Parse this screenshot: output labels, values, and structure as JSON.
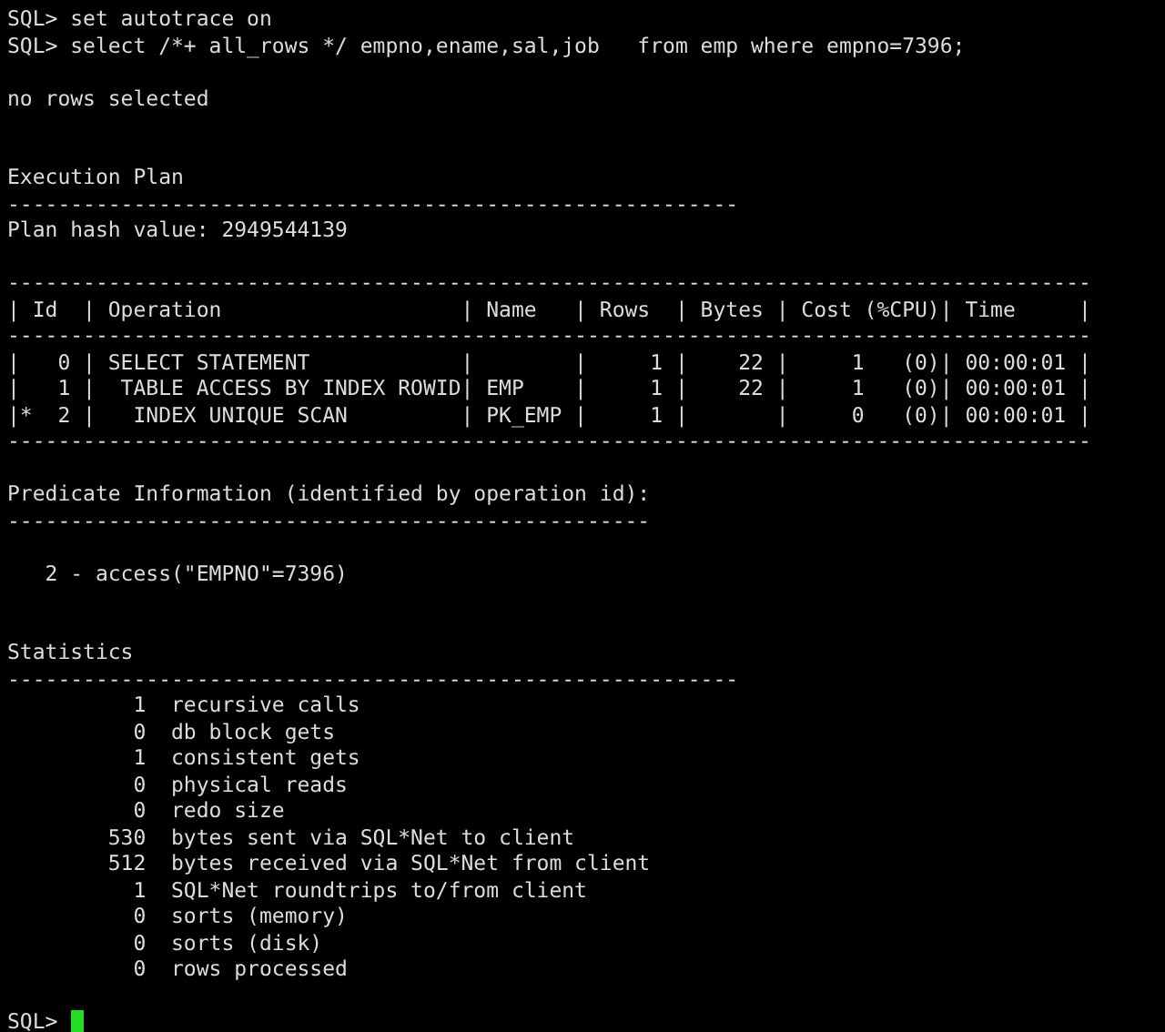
{
  "terminal": {
    "lines": [
      {
        "kind": "text",
        "text": "SQL> set autotrace on"
      },
      {
        "kind": "text",
        "text": "SQL> select /*+ all_rows */ empno,ename,sal,job   from emp where empno=7396;"
      },
      {
        "kind": "blank"
      },
      {
        "kind": "text",
        "text": "no rows selected"
      },
      {
        "kind": "blank"
      },
      {
        "kind": "blank"
      },
      {
        "kind": "text",
        "text": "Execution Plan"
      },
      {
        "kind": "rule",
        "text": "----------------------------------------------------------"
      },
      {
        "kind": "text",
        "text": "Plan hash value: 2949544139"
      },
      {
        "kind": "blank"
      },
      {
        "kind": "rule",
        "text": "--------------------------------------------------------------------------------------"
      },
      {
        "kind": "text",
        "text": "| Id  | Operation                   | Name   | Rows  | Bytes | Cost (%CPU)| Time     |"
      },
      {
        "kind": "rule",
        "text": "--------------------------------------------------------------------------------------"
      },
      {
        "kind": "text",
        "text": "|   0 | SELECT STATEMENT            |        |     1 |    22 |     1   (0)| 00:00:01 |"
      },
      {
        "kind": "text",
        "text": "|   1 |  TABLE ACCESS BY INDEX ROWID| EMP    |     1 |    22 |     1   (0)| 00:00:01 |"
      },
      {
        "kind": "text",
        "text": "|*  2 |   INDEX UNIQUE SCAN         | PK_EMP |     1 |       |     0   (0)| 00:00:01 |"
      },
      {
        "kind": "rule",
        "text": "--------------------------------------------------------------------------------------"
      },
      {
        "kind": "blank"
      },
      {
        "kind": "text",
        "text": "Predicate Information (identified by operation id):"
      },
      {
        "kind": "rule",
        "text": "---------------------------------------------------"
      },
      {
        "kind": "blank"
      },
      {
        "kind": "text",
        "text": "   2 - access(\"EMPNO\"=7396)"
      },
      {
        "kind": "blank"
      },
      {
        "kind": "blank"
      },
      {
        "kind": "text",
        "text": "Statistics"
      },
      {
        "kind": "rule",
        "text": "----------------------------------------------------------"
      },
      {
        "kind": "text",
        "text": "          1  recursive calls"
      },
      {
        "kind": "text",
        "text": "          0  db block gets"
      },
      {
        "kind": "text",
        "text": "          1  consistent gets"
      },
      {
        "kind": "text",
        "text": "          0  physical reads"
      },
      {
        "kind": "text",
        "text": "          0  redo size"
      },
      {
        "kind": "text",
        "text": "        530  bytes sent via SQL*Net to client"
      },
      {
        "kind": "text",
        "text": "        512  bytes received via SQL*Net from client"
      },
      {
        "kind": "text",
        "text": "          1  SQL*Net roundtrips to/from client"
      },
      {
        "kind": "text",
        "text": "          0  sorts (memory)"
      },
      {
        "kind": "text",
        "text": "          0  sorts (disk)"
      },
      {
        "kind": "text",
        "text": "          0  rows processed"
      },
      {
        "kind": "blank"
      },
      {
        "kind": "prompt",
        "text": "SQL>",
        "cursor": true
      }
    ]
  }
}
